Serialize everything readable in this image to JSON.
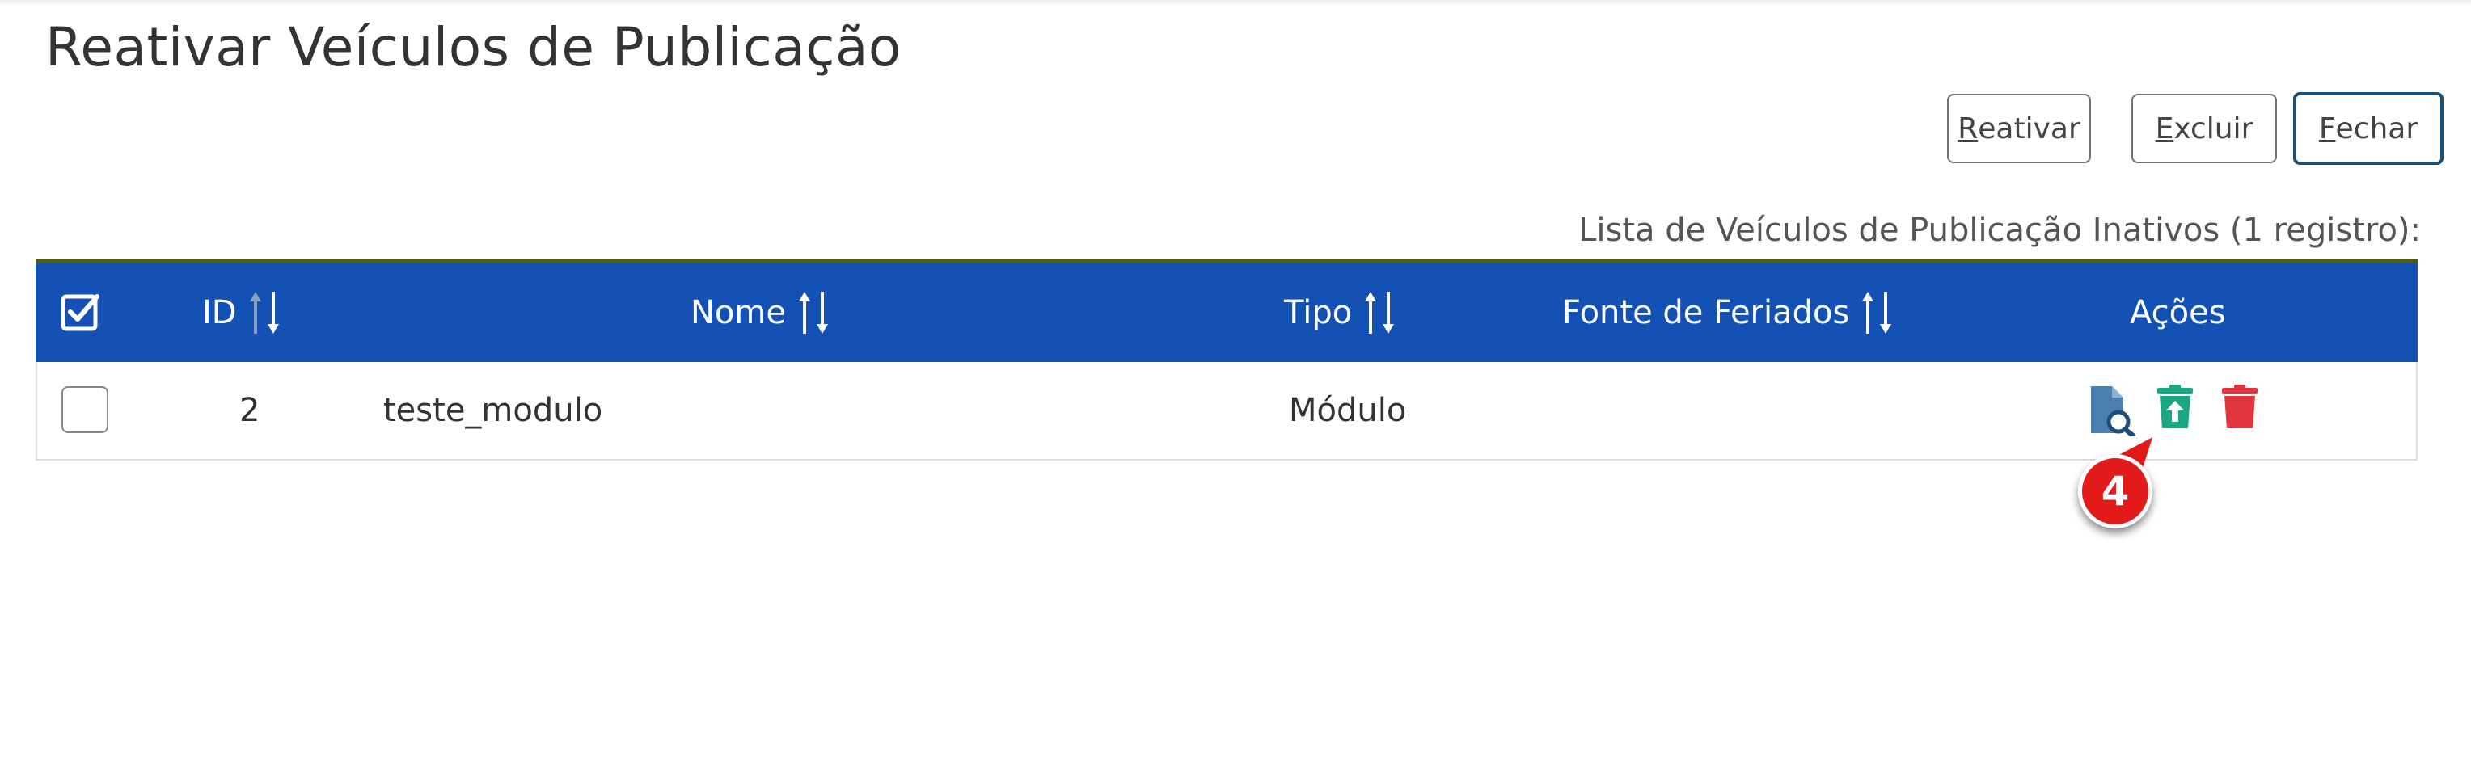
{
  "page": {
    "title": "Reativar Veículos de Publicação"
  },
  "toolbar": {
    "reativar": {
      "accel": "R",
      "rest": "eativar"
    },
    "excluir": {
      "accel": "E",
      "rest": "xcluir"
    },
    "fechar": {
      "accel": "F",
      "rest": "echar"
    }
  },
  "table": {
    "caption": "Lista de Veículos de Publicação Inativos (1 registro):",
    "headers": {
      "id": "ID",
      "nome": "Nome",
      "tipo": "Tipo",
      "fonte": "Fonte de Feriados",
      "acoes": "Ações"
    },
    "rows": [
      {
        "id": "2",
        "nome": "teste_modulo",
        "tipo": "Módulo",
        "fonte": ""
      }
    ]
  },
  "actions": {
    "view": {
      "icon": "document-search-icon",
      "color": "#4a7fb0"
    },
    "reactivate": {
      "icon": "reactivate-trash-icon",
      "color": "#1aa883"
    },
    "delete": {
      "icon": "trash-icon",
      "color": "#e0353f"
    }
  },
  "callout": {
    "label": "4"
  },
  "colors": {
    "header_bg": "#1351b4",
    "callout": "#e31a1a"
  }
}
